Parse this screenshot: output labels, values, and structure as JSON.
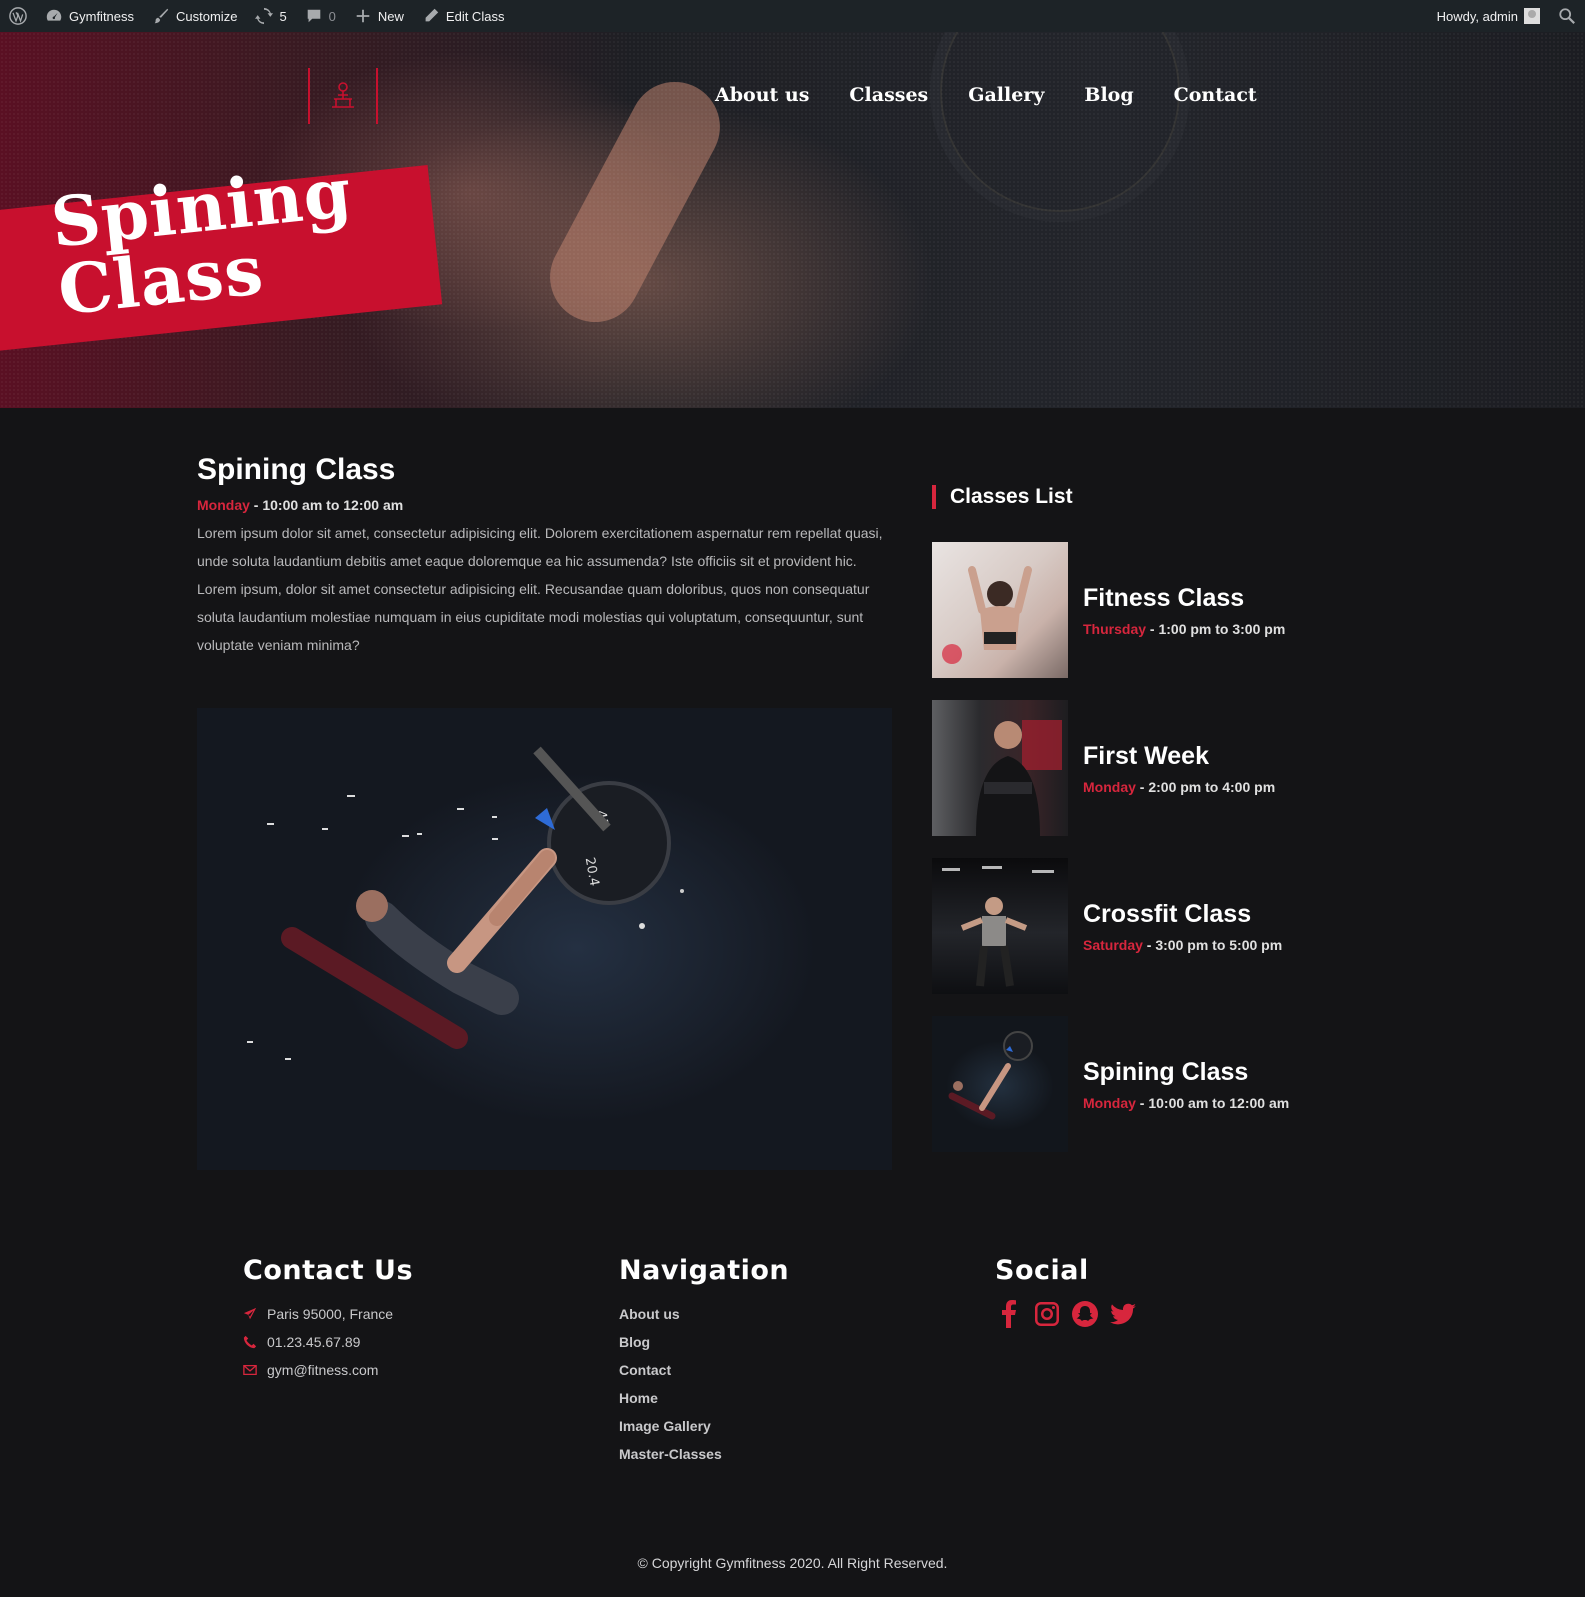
{
  "admin_bar": {
    "site_name": "Gymfitness",
    "customize": "Customize",
    "updates_count": "5",
    "comments_count": "0",
    "new": "New",
    "edit": "Edit Class",
    "howdy": "Howdy, admin"
  },
  "hero": {
    "banner_title": "Spining Class"
  },
  "nav": {
    "items": [
      "About us",
      "Classes",
      "Gallery",
      "Blog",
      "Contact"
    ]
  },
  "article": {
    "title": "Spining Class",
    "day": "Monday",
    "time": " - 10:00 am to 12:00 am",
    "paragraph_1": "Lorem ipsum dolor sit amet, consectetur adipisicing elit. Dolorem exercitationem aspernatur rem repellat quasi, unde soluta laudantium debitis amet eaque doloremque ea hic assumenda? Iste officiis sit et provident hic.",
    "paragraph_2": "Lorem ipsum, dolor sit amet consectetur adipisicing elit. Recusandae quam doloribus, quos non consequatur soluta laudantium molestiae numquam in eius cupiditate modi molestias qui voluptatum, consequuntur, sunt voluptate veniam minima?"
  },
  "sidebar": {
    "title": "Classes List",
    "classes": [
      {
        "name": "Fitness Class",
        "day": "Thursday",
        "time": " - 1:00 pm to 3:00 pm"
      },
      {
        "name": "First Week",
        "day": "Monday",
        "time": " - 2:00 pm to 4:00 pm"
      },
      {
        "name": "Crossfit Class",
        "day": "Saturday",
        "time": " - 3:00 pm to 5:00 pm"
      },
      {
        "name": "Spining Class",
        "day": "Monday",
        "time": " - 10:00 am to 12:00 am"
      }
    ]
  },
  "footer": {
    "contact": {
      "title": "Contact Us",
      "address": "Paris 95000, France",
      "phone": "01.23.45.67.89",
      "email": "gym@fitness.com"
    },
    "navigation": {
      "title": "Navigation",
      "links": [
        "About us",
        "Blog",
        "Contact",
        "Home",
        "Image Gallery",
        "Master-Classes"
      ]
    },
    "social": {
      "title": "Social",
      "icons": [
        "facebook-icon",
        "instagram-icon",
        "snapchat-icon",
        "twitter-icon"
      ]
    },
    "copyright": "© Copyright Gymfitness 2020. All Right Reserved."
  },
  "colors": {
    "accent": "#d7263d",
    "admin_bar": "#1d2327",
    "background": "#141416"
  }
}
